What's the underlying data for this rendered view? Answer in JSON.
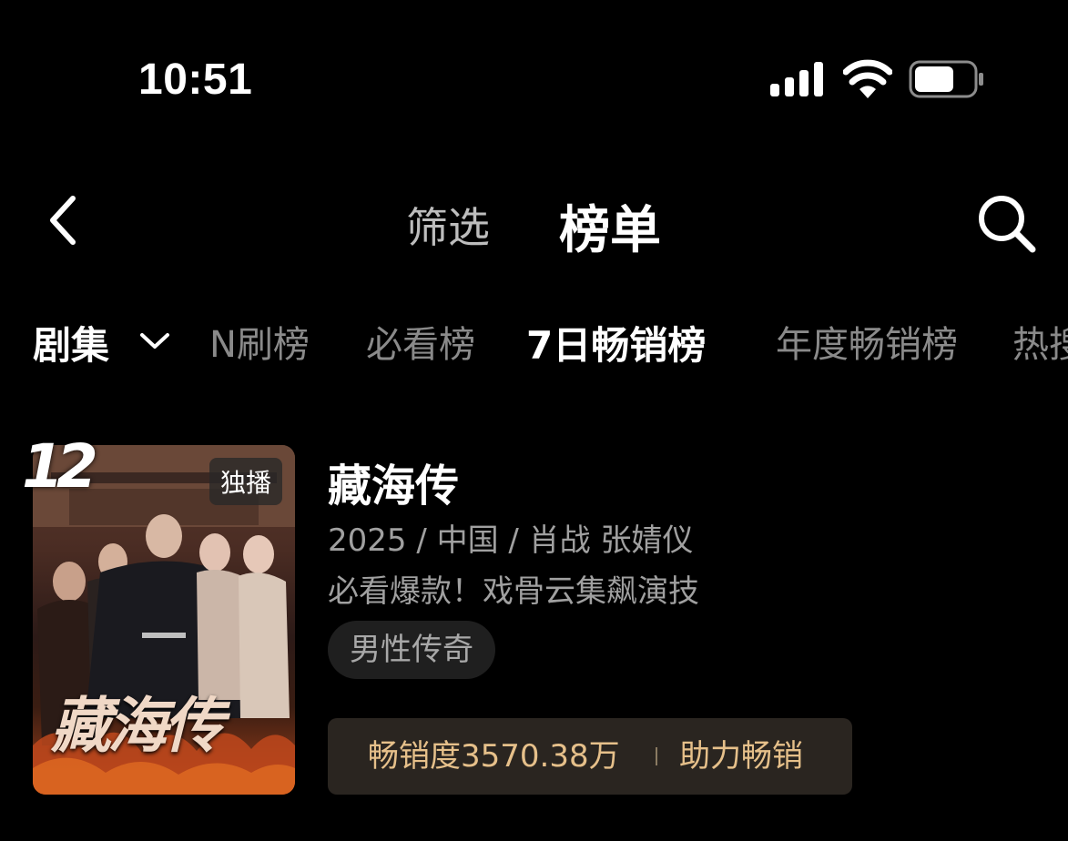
{
  "status_bar": {
    "time": "10:51",
    "icons": [
      "cellular-signal-icon",
      "wifi-icon",
      "battery-icon"
    ]
  },
  "nav": {
    "back_icon": "chevron-left-icon",
    "tabs": [
      {
        "label": "筛选",
        "active": false
      },
      {
        "label": "榜单",
        "active": true
      }
    ],
    "search_icon": "search-icon"
  },
  "categories": {
    "dropdown_label": "剧集",
    "items": [
      {
        "label": "N刷榜",
        "active": false
      },
      {
        "label": "必看榜",
        "active": false
      },
      {
        "label": "7日畅销榜",
        "active": true
      },
      {
        "label": "年度畅销榜",
        "active": false
      },
      {
        "label": "热搜",
        "active": false
      }
    ]
  },
  "listing": {
    "rank": "12",
    "exclusive_badge": "独播",
    "poster_title": "藏海传",
    "title": "藏海传",
    "meta": "2025 / 中国 / 肖战 张婧仪",
    "tagline": "必看爆款！戏骨云集飙演技",
    "genre_tag": "男性传奇",
    "sales_label": "畅销度3570.38万",
    "boost_label": "助力畅销"
  },
  "colors": {
    "background": "#000000",
    "accent_gold": "#e6c08a",
    "muted_text": "#a0a0a0"
  }
}
